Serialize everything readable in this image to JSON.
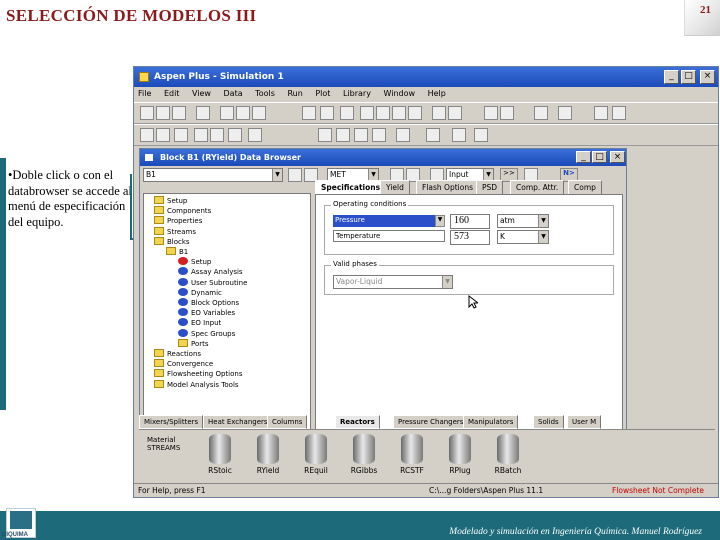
{
  "slide": {
    "title": "SELECCIÓN DE MODELOS III",
    "page_number": "21",
    "bullet": "•Doble click o con el databrowser se accede al menú de especificación del equipo.",
    "footer": "Modelado y simulación en Ingeniería Química. Manuel Rodríguez",
    "logo_text": "DIQUIMA"
  },
  "app": {
    "title": "Aspen Plus - Simulation 1",
    "menu": [
      "File",
      "Edit",
      "View",
      "Data",
      "Tools",
      "Run",
      "Plot",
      "Library",
      "Window",
      "Help"
    ],
    "window_buttons": [
      "_",
      "□",
      "×"
    ]
  },
  "browser": {
    "title": "Block B1 (RYield) Data Browser",
    "block_combo": "B1",
    "units_combo": "MET",
    "nav_combo": "Input",
    "nav_next": ">>",
    "nav_new": "N>",
    "tree": [
      {
        "label": "Setup",
        "icon": "folder",
        "level": 1
      },
      {
        "label": "Components",
        "icon": "folder",
        "level": 1
      },
      {
        "label": "Properties",
        "icon": "folder",
        "level": 1
      },
      {
        "label": "Streams",
        "icon": "folder",
        "level": 1
      },
      {
        "label": "Blocks",
        "icon": "folder",
        "level": 1
      },
      {
        "label": "B1",
        "icon": "folder",
        "level": 2
      },
      {
        "label": "Setup",
        "icon": "red",
        "level": 3
      },
      {
        "label": "Assay Analysis",
        "icon": "blue",
        "level": 3
      },
      {
        "label": "User Subroutine",
        "icon": "blue",
        "level": 3
      },
      {
        "label": "Dynamic",
        "icon": "blue",
        "level": 3
      },
      {
        "label": "Block Options",
        "icon": "blue",
        "level": 3
      },
      {
        "label": "EO Variables",
        "icon": "blue",
        "level": 3
      },
      {
        "label": "EO Input",
        "icon": "blue",
        "level": 3
      },
      {
        "label": "Spec Groups",
        "icon": "blue",
        "level": 3
      },
      {
        "label": "Ports",
        "icon": "folder",
        "level": 3
      },
      {
        "label": "Reactions",
        "icon": "folder",
        "level": 1
      },
      {
        "label": "Convergence",
        "icon": "folder",
        "level": 1
      },
      {
        "label": "Flowsheeting Options",
        "icon": "folder",
        "level": 1
      },
      {
        "label": "Model Analysis Tools",
        "icon": "folder",
        "level": 1
      }
    ],
    "tabs": [
      "Specifications",
      "Yield",
      "Flash Options",
      "PSD",
      "Comp. Attr.",
      "Comp"
    ],
    "group_operating": "Operating conditions",
    "fields": [
      {
        "name": "Pressure",
        "value": "160",
        "unit": "atm"
      },
      {
        "name": "Temperature",
        "value": "573",
        "unit": "K"
      }
    ],
    "group_valid": "Valid phases",
    "valid_phase": "Vapor-Liquid"
  },
  "library": {
    "tabs": [
      "Mixers/Splitters",
      "Heat Exchangers",
      "Columns",
      "Reactors",
      "Pressure Changers",
      "Manipulators",
      "Solids",
      "User M"
    ],
    "selected_tab": "Reactors",
    "mixer_label": "Material STREAMS",
    "models": [
      "RStoic",
      "RYield",
      "REquil",
      "RGibbs",
      "RCSTF",
      "RPlug",
      "RBatch"
    ]
  },
  "status": {
    "help": "For Help, press F1",
    "path": "C:\\...g Folders\\Aspen Plus 11.1",
    "state": "Flowsheet Not Complete"
  },
  "colors": {
    "accent": "#1d6a7a",
    "title": "#8b1a1a",
    "titlebar": "#1c4bb9"
  }
}
